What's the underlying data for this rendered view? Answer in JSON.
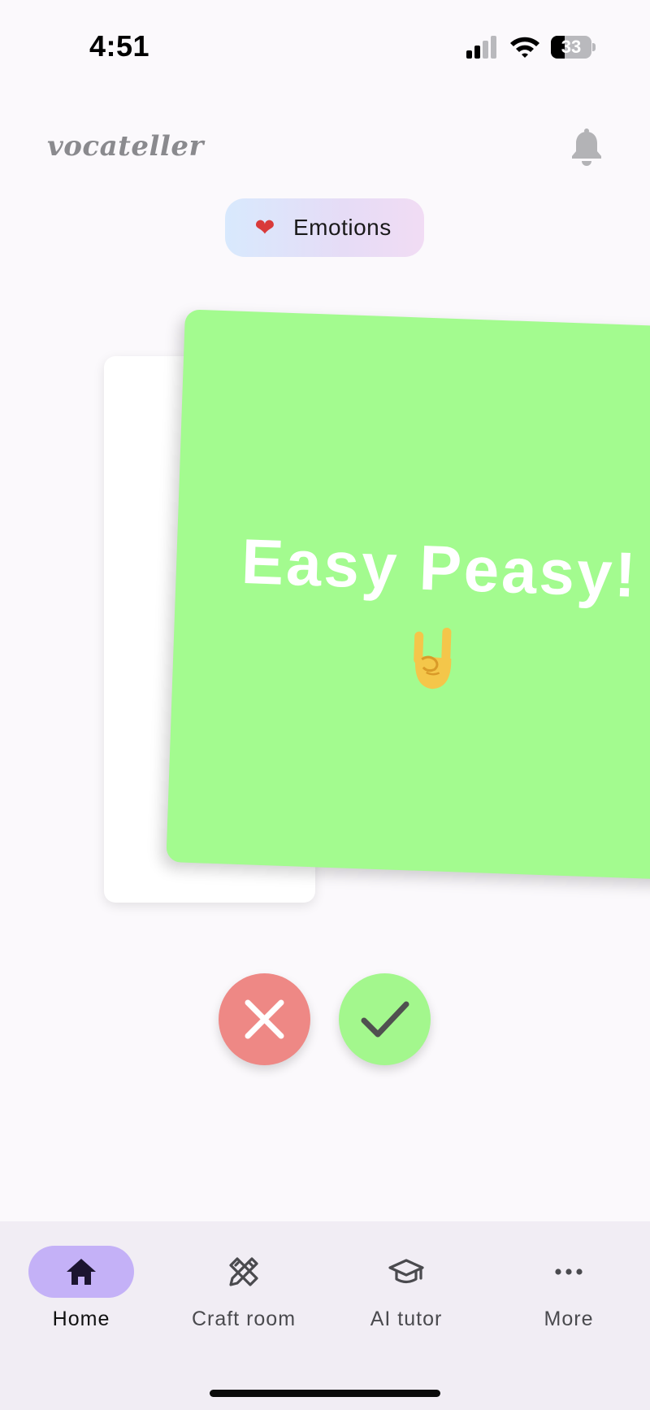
{
  "status_bar": {
    "time": "4:51",
    "battery_level": "33",
    "battery_fraction": 0.33,
    "icons": [
      "signal-icon",
      "wifi-icon",
      "battery-icon"
    ]
  },
  "header": {
    "brand": "vocateller",
    "notification_icon": "bell-icon"
  },
  "category": {
    "emoji": "❤",
    "label": "Emotions"
  },
  "card": {
    "text": "Easy Peasy!",
    "emoji_name": "sign-of-the-horns",
    "color": "#a3fb8f"
  },
  "actions": {
    "reject_icon": "close-icon",
    "reject_color": "#ee8885",
    "accept_icon": "check-icon",
    "accept_color": "#a3f78d"
  },
  "nav": {
    "active_color": "#c4b1f7",
    "items": [
      {
        "label": "Home",
        "icon": "home-icon",
        "active": true
      },
      {
        "label": "Craft room",
        "icon": "ruler-pencil-icon",
        "active": false
      },
      {
        "label": "AI tutor",
        "icon": "graduation-cap-icon",
        "active": false
      },
      {
        "label": "More",
        "icon": "more-icon",
        "active": false
      }
    ]
  }
}
